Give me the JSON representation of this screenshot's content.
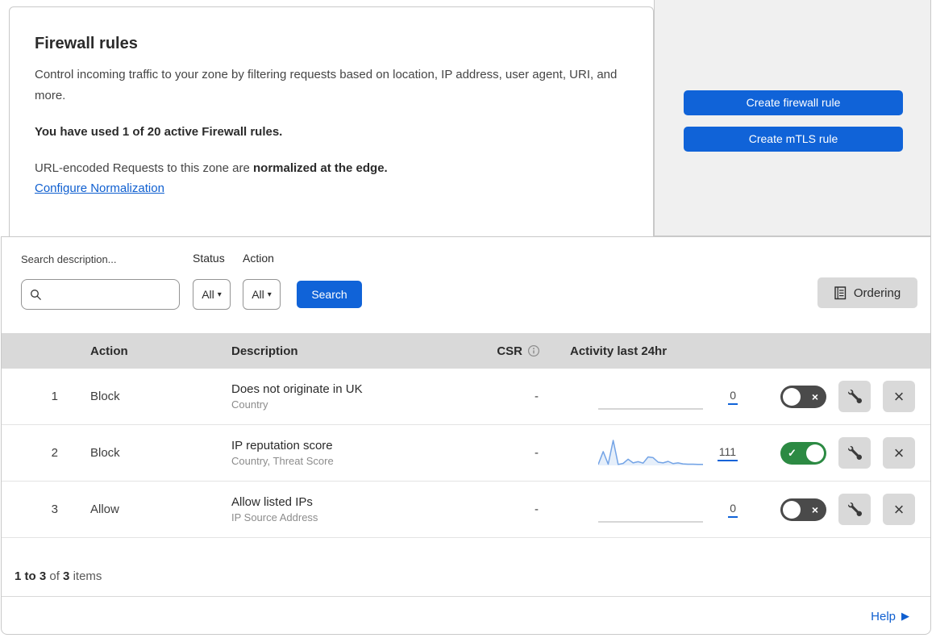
{
  "colors": {
    "accent_blue": "#1063d8",
    "link_blue": "#0f5fd0",
    "toggle_on_green": "#2c8a43",
    "toggle_off_gray": "#4a4a4a",
    "table_header_gray": "#d9d9d9",
    "panel_gray": "#f0f0f0",
    "sparkline_stroke": "#74a4e6",
    "sparkline_fill": "rgba(116,164,230,0.18)"
  },
  "header": {
    "title": "Firewall rules",
    "description": "Control incoming traffic to your zone by filtering requests based on location, IP address, user agent, URI, and more.",
    "usage": "You have used 1 of 20 active Firewall rules.",
    "normalization_text": "URL-encoded Requests to this zone are ",
    "normalization_bold": "normalized at the edge.",
    "link": "Configure Normalization"
  },
  "actions_panel": {
    "create_firewall_label": "Create firewall rule",
    "create_mtls_label": "Create mTLS rule"
  },
  "filters": {
    "search_label": "Search description...",
    "search_value": "",
    "status_label": "Status",
    "status_value": "All",
    "action_label": "Action",
    "action_value": "All",
    "search_button_label": "Search",
    "ordering_label": "Ordering"
  },
  "table": {
    "headers": {
      "action": "Action",
      "description": "Description",
      "csr": "CSR",
      "activity": "Activity last 24hr"
    },
    "rows": [
      {
        "index": "1",
        "action": "Block",
        "description": "Does not originate in UK",
        "fields": "Country",
        "csr": "-",
        "count": "0",
        "enabled": false,
        "activity": []
      },
      {
        "index": "2",
        "action": "Block",
        "description": "IP reputation score",
        "fields": "Country, Threat Score",
        "csr": "-",
        "count": "111",
        "enabled": true,
        "activity": [
          4,
          55,
          5,
          100,
          4,
          8,
          25,
          10,
          15,
          9,
          34,
          31,
          13,
          10,
          16,
          7,
          10,
          6,
          5,
          5,
          4,
          4
        ]
      },
      {
        "index": "3",
        "action": "Allow",
        "description": "Allow listed IPs",
        "fields": "IP Source Address",
        "csr": "-",
        "count": "0",
        "enabled": false,
        "activity": []
      }
    ]
  },
  "footer": {
    "range_bold": "1 to 3",
    "of_text": "of",
    "total_bold": "3",
    "items_text": "items"
  },
  "help_label": "Help",
  "icons": {
    "chevron_down": "▾",
    "help_arrow": "▶",
    "check": "✓",
    "cross": "×",
    "close": "×"
  }
}
